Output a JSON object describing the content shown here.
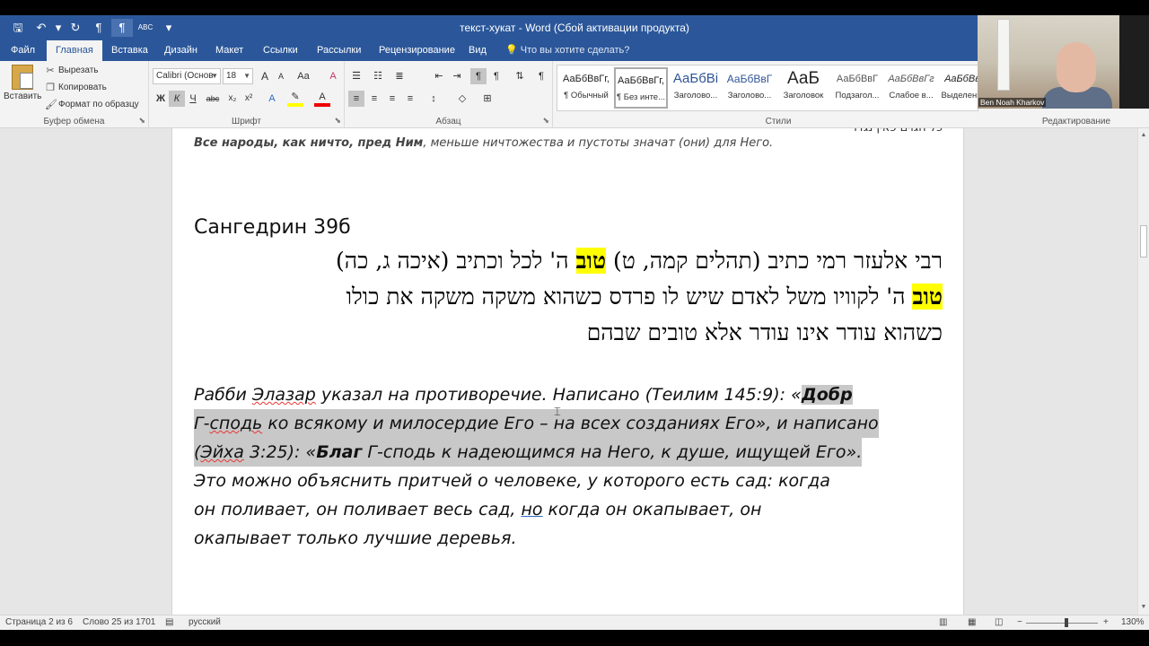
{
  "window": {
    "title": "текст-хукат - Word (Сбой активации продукта)"
  },
  "qat": {
    "save": "🖫",
    "undo": "↶",
    "undo_dd": "▾",
    "redo": "↻",
    "para_left": "¶",
    "para_right": "¶",
    "spell": "ABC",
    "customize": "▾"
  },
  "tabs": [
    "Файл",
    "Главная",
    "Вставка",
    "Дизайн",
    "Макет",
    "Ссылки",
    "Рассылки",
    "Рецензирование",
    "Вид"
  ],
  "tell_me": "Что вы хотите сделать?",
  "clipboard": {
    "paste": "Вставить",
    "cut": "Вырезать",
    "copy": "Копировать",
    "format_painter": "Формат по образцу",
    "group_label": "Буфер обмена"
  },
  "font": {
    "name": "Calibri (Основ",
    "size": "18",
    "group_label": "Шрифт",
    "bold": "Ж",
    "italic": "К",
    "underline": "Ч",
    "strike": "abc",
    "sub": "x₂",
    "sup": "x²",
    "grow": "A",
    "shrink": "A",
    "case": "Aa",
    "clear": "A"
  },
  "paragraph": {
    "group_label": "Абзац"
  },
  "styles": {
    "group_label": "Стили",
    "items": [
      {
        "sample": "АаБбВвГг,",
        "name": "¶ Обычный"
      },
      {
        "sample": "АаБбВвГг,",
        "name": "¶ Без инте..."
      },
      {
        "sample": "АаБбВі",
        "name": "Заголово..."
      },
      {
        "sample": "АаБбВвГ",
        "name": "Заголово..."
      },
      {
        "sample": "АаБ",
        "name": "Заголовок"
      },
      {
        "sample": "АаБбВвГ",
        "name": "Подзагол..."
      },
      {
        "sample": "АаБбВвГг",
        "name": "Слабое в..."
      },
      {
        "sample": "АаБбВвГ",
        "name": "Выделени..."
      }
    ]
  },
  "editing": {
    "group_label": "Редактирование"
  },
  "video": {
    "participant": "Ben Noah Kharkov"
  },
  "document": {
    "line1_bold": "Все народы, как ничто, пред Ним",
    "line1_rest": ", меньше ничтожества и пустоты значат (они) для Него.",
    "heading": "Сангедрин 39б",
    "heb1_a": "רבי אלעזר רמי כתיב (תהלים קמה, ט) ",
    "heb1_hl": "טוב",
    "heb1_b": " ה' לכל וכתיב (איכה ג, כה)",
    "heb2_hl": "טוב",
    "heb2_b": " ה' לקוויו משל לאדם שיש לו פרדס כשהוא משקה משקה את כולו",
    "heb3": "כשהוא עודר אינו עודר אלא טובים שבהם",
    "ru1_a": "Рабби ",
    "ru1_name": "Элазар",
    "ru1_b": " указал на противоречие. Написано (Теилим 145:9): «",
    "ru1_bold": "Добр",
    "ru2_a": "Г-",
    "ru2_w": "сподь",
    "ru2_b": " ко всякому и милосердие Его – на всех созданиях Его», и написано",
    "ru3_a": "(",
    "ru3_w": "Эйха",
    "ru3_b": " 3:25): «",
    "ru3_bold": "Благ",
    "ru3_c": " Г-сподь к надеющимся на Него, к душе, ищущей Его».",
    "ru4": "Это можно объяснить притчей о человеке, у которого есть сад: когда",
    "ru5_a": "он поливает, он поливает весь сад, ",
    "ru5_w": "но",
    "ru5_b": " когда он окапывает, он",
    "ru6": "окапывает только лучшие деревья."
  },
  "status": {
    "page": "Страница 2 из 6",
    "words": "Слово 25 из 1701",
    "lang": "русский",
    "zoom": "130%",
    "zoom_minus": "−",
    "zoom_plus": "+"
  }
}
